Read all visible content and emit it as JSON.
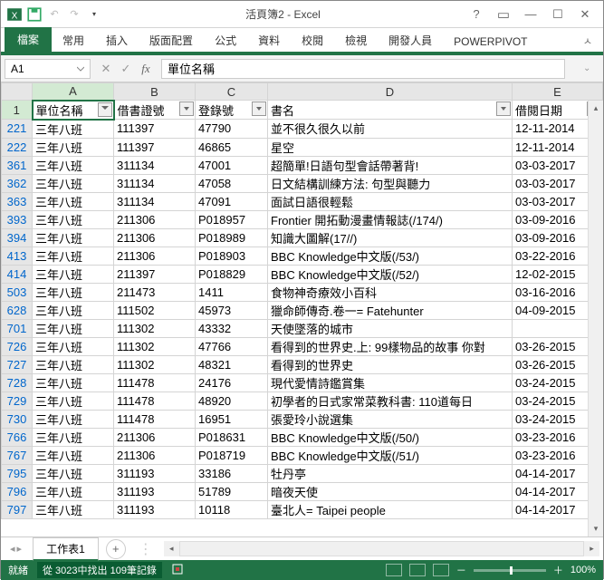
{
  "titlebar": {
    "title": "活頁簿2 - Excel"
  },
  "ribbon": {
    "file": "檔案",
    "tabs": [
      "常用",
      "插入",
      "版面配置",
      "公式",
      "資料",
      "校閱",
      "檢視",
      "開發人員",
      "POWERPIVOT"
    ]
  },
  "formula_bar": {
    "namebox": "A1",
    "formula": "單位名稱"
  },
  "columns": [
    "",
    "A",
    "B",
    "C",
    "D",
    "E"
  ],
  "headers": {
    "A": "單位名稱",
    "B": "借書證號",
    "C": "登錄號",
    "D": "書名",
    "E": "借閱日期"
  },
  "rows": [
    {
      "n": "221",
      "A": "三年八班",
      "B": "111397",
      "C": "47790",
      "D": "並不很久很久以前",
      "E": "12-11-2014"
    },
    {
      "n": "222",
      "A": "三年八班",
      "B": "111397",
      "C": "46865",
      "D": "星空",
      "E": "12-11-2014"
    },
    {
      "n": "361",
      "A": "三年八班",
      "B": "311134",
      "C": "47001",
      "D": "超簡單!日語句型會話帶著背!",
      "E": "03-03-2017"
    },
    {
      "n": "362",
      "A": "三年八班",
      "B": "311134",
      "C": "47058",
      "D": "日文結構訓練方法: 句型與聽力",
      "E": "03-03-2017"
    },
    {
      "n": "363",
      "A": "三年八班",
      "B": "311134",
      "C": "47091",
      "D": "面試日語很輕鬆",
      "E": "03-03-2017"
    },
    {
      "n": "393",
      "A": "三年八班",
      "B": "211306",
      "C": "P018957",
      "D": "Frontier 開拓動漫畫情報誌(/174/)",
      "E": "03-09-2016"
    },
    {
      "n": "394",
      "A": "三年八班",
      "B": "211306",
      "C": "P018989",
      "D": "知識大圖解(17//)",
      "E": "03-09-2016"
    },
    {
      "n": "413",
      "A": "三年八班",
      "B": "211306",
      "C": "P018903",
      "D": "BBC Knowledge中文版(/53/)",
      "E": "03-22-2016"
    },
    {
      "n": "414",
      "A": "三年八班",
      "B": "211397",
      "C": "P018829",
      "D": "BBC Knowledge中文版(/52/)",
      "E": "12-02-2015"
    },
    {
      "n": "503",
      "A": "三年八班",
      "B": "211473",
      "C": "1411",
      "D": "食物神奇療效小百科",
      "E": "03-16-2016"
    },
    {
      "n": "628",
      "A": "三年八班",
      "B": "111502",
      "C": "45973",
      "D": "獵命師傳奇.卷一= Fatehunter",
      "E": "04-09-2015"
    },
    {
      "n": "701",
      "A": "三年八班",
      "B": "111302",
      "C": "43332",
      "D": "天使墜落的城市",
      "E": ""
    },
    {
      "n": "726",
      "A": "三年八班",
      "B": "111302",
      "C": "47766",
      "D": "看得到的世界史.上: 99樣物品的故事 你對",
      "E": "03-26-2015"
    },
    {
      "n": "727",
      "A": "三年八班",
      "B": "111302",
      "C": "48321",
      "D": "看得到的世界史",
      "E": "03-26-2015"
    },
    {
      "n": "728",
      "A": "三年八班",
      "B": "111478",
      "C": "24176",
      "D": "現代愛情詩鑑賞集",
      "E": "03-24-2015"
    },
    {
      "n": "729",
      "A": "三年八班",
      "B": "111478",
      "C": "48920",
      "D": "初學者的日式家常菜教科書: 110道每日",
      "E": "03-24-2015"
    },
    {
      "n": "730",
      "A": "三年八班",
      "B": "111478",
      "C": "16951",
      "D": "張愛玲小說選集",
      "E": "03-24-2015"
    },
    {
      "n": "766",
      "A": "三年八班",
      "B": "211306",
      "C": "P018631",
      "D": "BBC Knowledge中文版(/50/)",
      "E": "03-23-2016"
    },
    {
      "n": "767",
      "A": "三年八班",
      "B": "211306",
      "C": "P018719",
      "D": "BBC Knowledge中文版(/51/)",
      "E": "03-23-2016"
    },
    {
      "n": "795",
      "A": "三年八班",
      "B": "311193",
      "C": "33186",
      "D": "牡丹亭",
      "E": "04-14-2017"
    },
    {
      "n": "796",
      "A": "三年八班",
      "B": "311193",
      "C": "51789",
      "D": "暗夜天使",
      "E": "04-14-2017"
    },
    {
      "n": "797",
      "A": "三年八班",
      "B": "311193",
      "C": "10118",
      "D": "臺北人= Taipei people",
      "E": "04-14-2017"
    }
  ],
  "sheet_tabs": {
    "active": "工作表1",
    "add": "+"
  },
  "statusbar": {
    "ready": "就緒",
    "selection": "從 3023中找出 109筆記錄",
    "zoom": "100%"
  }
}
